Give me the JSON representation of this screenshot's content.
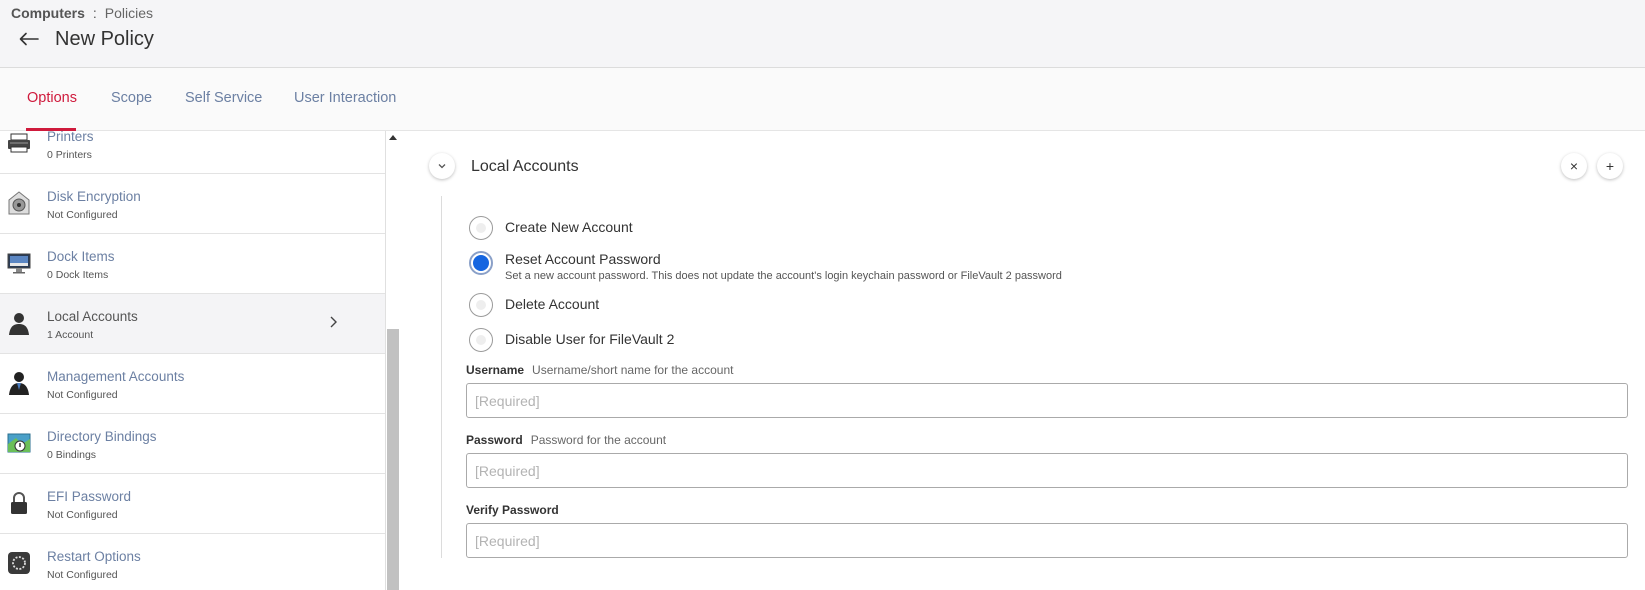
{
  "breadcrumb": {
    "parent": "Computers",
    "separator": ":",
    "current": "Policies"
  },
  "page": {
    "title": "New Policy",
    "back_icon": "arrow-left-icon"
  },
  "tabs": [
    {
      "label": "Options",
      "active": true
    },
    {
      "label": "Scope",
      "active": false
    },
    {
      "label": "Self Service",
      "active": false
    },
    {
      "label": "User Interaction",
      "active": false
    }
  ],
  "sidebar": {
    "items": [
      {
        "label": "Printers",
        "sub": "0 Printers",
        "icon": "printer-icon"
      },
      {
        "label": "Disk Encryption",
        "sub": "Not Configured",
        "icon": "disk-encryption-icon"
      },
      {
        "label": "Dock Items",
        "sub": "0 Dock Items",
        "icon": "monitor-icon"
      },
      {
        "label": "Local Accounts",
        "sub": "1 Account",
        "icon": "user-icon",
        "selected": true
      },
      {
        "label": "Management Accounts",
        "sub": "Not Configured",
        "icon": "admin-user-icon"
      },
      {
        "label": "Directory Bindings",
        "sub": "0 Bindings",
        "icon": "directory-icon"
      },
      {
        "label": "EFI Password",
        "sub": "Not Configured",
        "icon": "lock-icon"
      },
      {
        "label": "Restart Options",
        "sub": "Not Configured",
        "icon": "restart-icon"
      }
    ]
  },
  "section": {
    "title": "Local Accounts",
    "options": [
      {
        "label": "Create New Account",
        "checked": false
      },
      {
        "label": "Reset Account Password",
        "checked": true,
        "description": "Set a new account password. This does not update the account's login keychain password or FileVault 2 password"
      },
      {
        "label": "Delete Account",
        "checked": false
      },
      {
        "label": "Disable User for FileVault 2",
        "checked": false
      }
    ],
    "fields": {
      "username": {
        "label": "Username",
        "hint": "Username/short name for the account",
        "placeholder": "[Required]",
        "value": ""
      },
      "password": {
        "label": "Password",
        "hint": "Password for the account",
        "placeholder": "[Required]",
        "value": ""
      },
      "verify": {
        "label": "Verify Password",
        "placeholder": "[Required]",
        "value": ""
      }
    },
    "remove_symbol": "×",
    "add_symbol": "+"
  },
  "colors": {
    "accent_red": "#cf1a3c",
    "link_blue": "#6c80a3",
    "radio_blue": "#1565e0"
  }
}
